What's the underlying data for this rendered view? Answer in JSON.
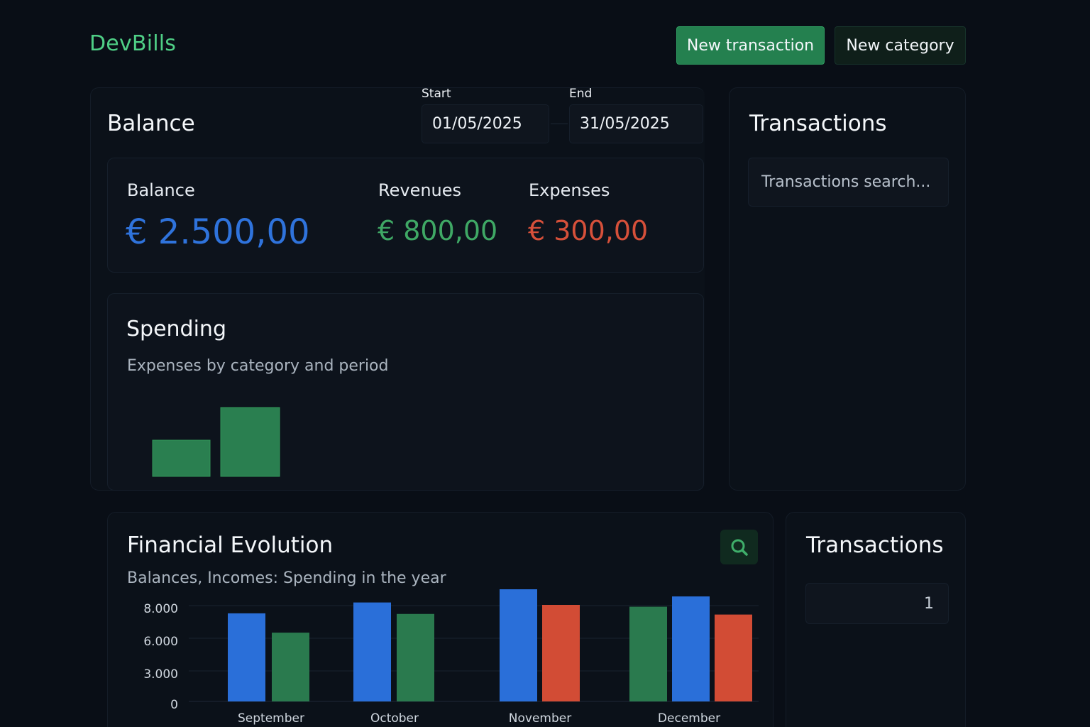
{
  "header": {
    "logo": "DevBills",
    "new_transaction_label": "New transaction",
    "new_category_label": "New category"
  },
  "balance_panel": {
    "title": "Balance",
    "start_label": "Start",
    "start_value": "01/05/2025",
    "end_label": "End",
    "end_value": "31/05/2025",
    "summary": {
      "balance_label": "Balance",
      "balance_value": "€ 2.500,00",
      "revenues_label": "Revenues",
      "revenues_value": "€ 800,00",
      "expenses_label": "Expenses",
      "expenses_value": "€ 300,00"
    }
  },
  "spending": {
    "title": "Spending",
    "subtitle": "Expenses by category and period"
  },
  "transactions": {
    "title": "Transactions",
    "search_placeholder": "Transactions search..."
  },
  "evolution": {
    "title": "Financial Evolution",
    "subtitle": "Balances, Incomes: Spending in the year"
  },
  "transactions_bottom": {
    "title": "Transactions",
    "page": "1"
  },
  "colors": {
    "accent_green": "#2a7f50",
    "balance_blue": "#2f73dc",
    "revenue_green": "#3fa865",
    "expense_red": "#d6503a"
  },
  "chart_data": [
    {
      "type": "bar",
      "title": "Spending",
      "series": [
        {
          "values": [
            1,
            2
          ]
        }
      ],
      "categories": [
        "",
        ""
      ],
      "grid": false
    },
    {
      "type": "bar",
      "title": "Financial Evolution",
      "categories": [
        "September",
        "October",
        "November",
        "December"
      ],
      "ytick_labels": [
        "0",
        "3.000",
        "6.000",
        "8.000"
      ],
      "ylim": [
        0,
        8000
      ],
      "grid": true,
      "bars": [
        {
          "category": "September",
          "color": "#2a6fd9",
          "value": 7300
        },
        {
          "category": "September",
          "color": "#2a7a4e",
          "value": 5700
        },
        {
          "category": "October",
          "color": "#2a6fd9",
          "value": 8200
        },
        {
          "category": "October",
          "color": "#2a7a4e",
          "value": 7250
        },
        {
          "category": "November",
          "color": "#2a6fd9",
          "value": 9300
        },
        {
          "category": "November",
          "color": "#d24c35",
          "value": 8000
        },
        {
          "category": "December",
          "color": "#2a7a4e",
          "value": 7850
        },
        {
          "category": "December",
          "color": "#2a6fd9",
          "value": 8700
        },
        {
          "category": "December",
          "color": "#d24c35",
          "value": 7200
        }
      ]
    }
  ]
}
